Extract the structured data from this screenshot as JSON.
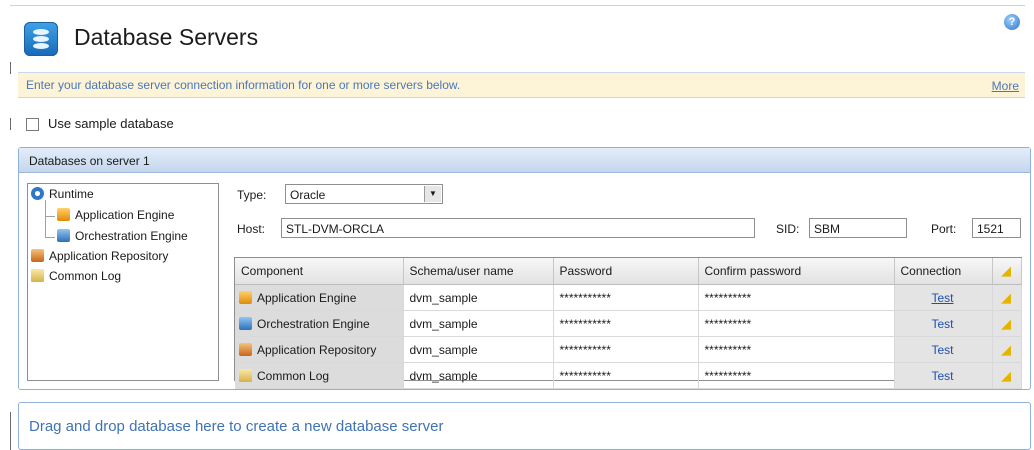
{
  "header": {
    "title": "Database Servers",
    "help_icon": "help-icon"
  },
  "info_bar": {
    "text": "Enter your database server connection information for one or more servers below.",
    "more_label": "More"
  },
  "sample_db": {
    "label": "Use sample database",
    "checked": false
  },
  "group": {
    "title": "Databases on server 1",
    "tree": [
      {
        "label": "Runtime",
        "icon": "runtime-icon"
      },
      {
        "label": "Application Engine",
        "icon": "application-engine-icon"
      },
      {
        "label": "Orchestration Engine",
        "icon": "orchestration-engine-icon"
      },
      {
        "label": "Application Repository",
        "icon": "application-repository-icon"
      },
      {
        "label": "Common Log",
        "icon": "common-log-icon"
      }
    ],
    "type": {
      "label": "Type:",
      "value": "Oracle"
    },
    "host": {
      "label": "Host:",
      "value": "STL-DVM-ORCLA"
    },
    "sid": {
      "label": "SID:",
      "value": "SBM"
    },
    "port": {
      "label": "Port:",
      "value": "1521"
    },
    "table": {
      "headers": [
        "Component",
        "Schema/user name",
        "Password",
        "Confirm password",
        "Connection"
      ],
      "rows": [
        {
          "component": "Application Engine",
          "schema": "dvm_sample",
          "password": "***********",
          "confirm": "**********",
          "connection": "Test"
        },
        {
          "component": "Orchestration Engine",
          "schema": "dvm_sample",
          "password": "***********",
          "confirm": "**********",
          "connection": "Test"
        },
        {
          "component": "Application Repository",
          "schema": "dvm_sample",
          "password": "***********",
          "confirm": "**********",
          "connection": "Test"
        },
        {
          "component": "Common Log",
          "schema": "dvm_sample",
          "password": "***********",
          "confirm": "**********",
          "connection": "Test"
        }
      ]
    }
  },
  "drop_zone": {
    "text": "Drag and drop database here to create a new database server"
  },
  "colors": {
    "accent": "#3f73b5",
    "info_bg": "#fdf3d7",
    "group_border": "#8fb0d8"
  }
}
